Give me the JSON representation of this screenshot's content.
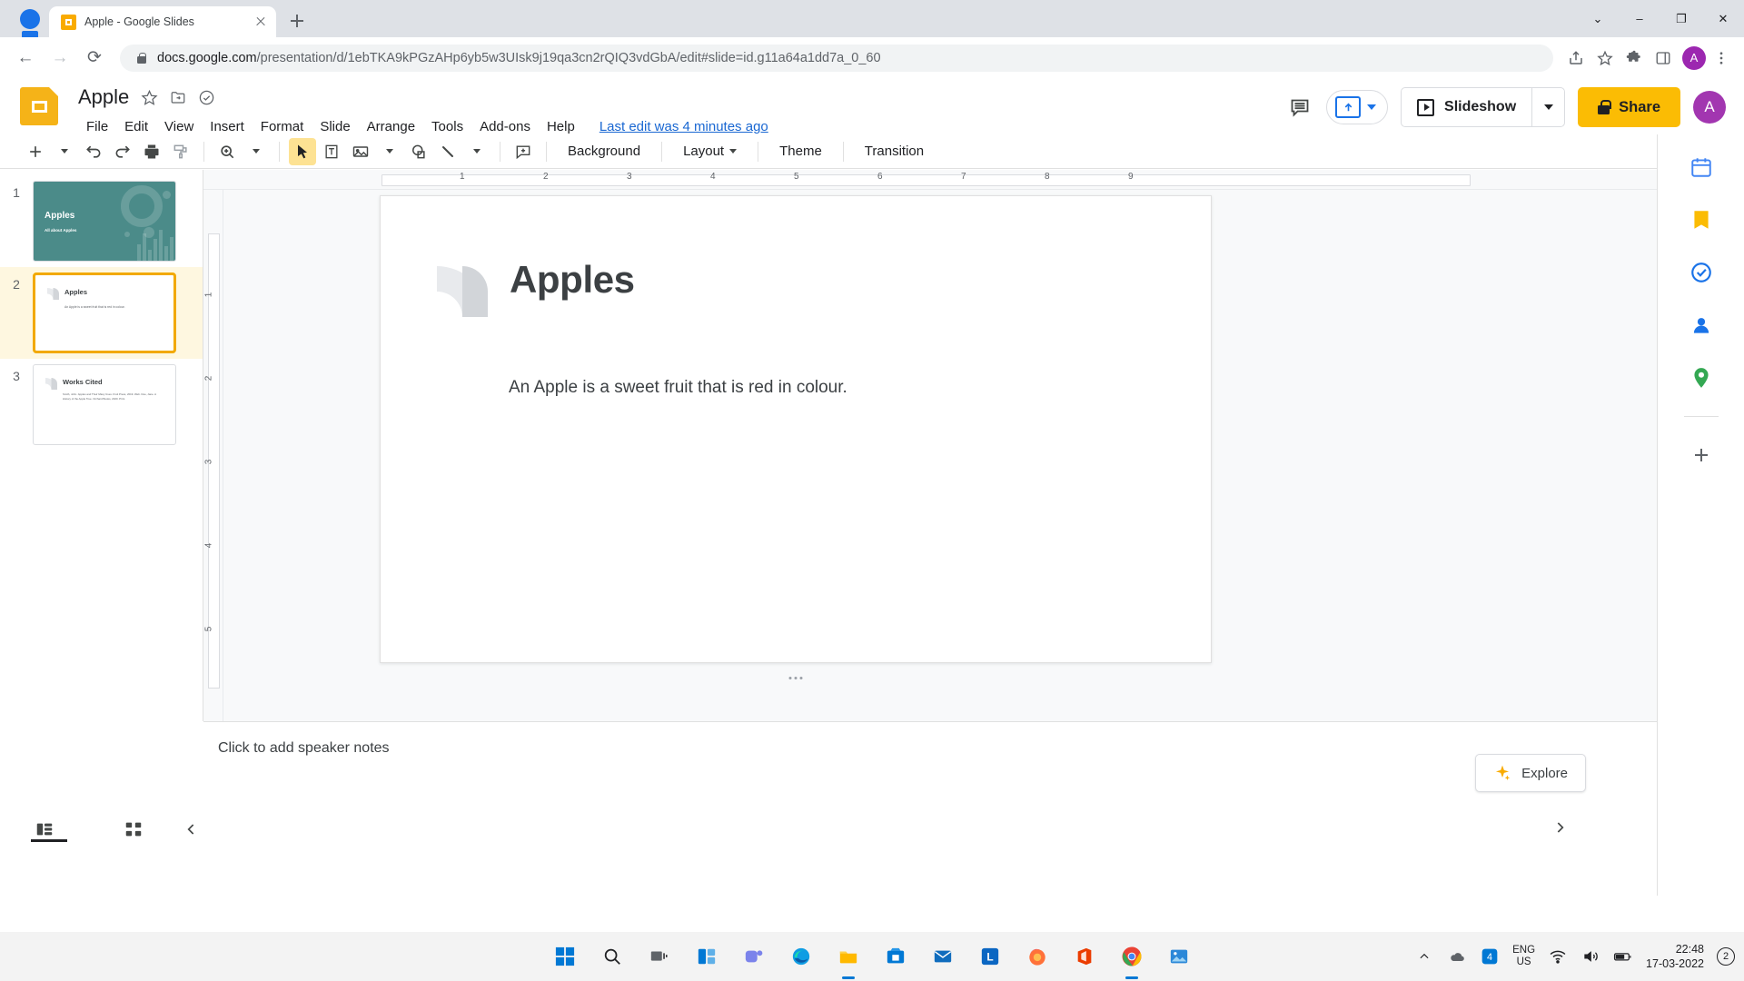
{
  "browser": {
    "tab": {
      "title": "Apple - Google Slides",
      "favicon": "slides-favicon"
    },
    "new_tab_label": "+",
    "window_controls": {
      "minimize": "–",
      "maximize": "❐",
      "close": "✕",
      "more": "⌄"
    },
    "nav": {
      "back": "←",
      "forward": "→",
      "reload": "⟳"
    },
    "url_domain": "docs.google.com",
    "url_path": "/presentation/d/1ebTKA9kPGzAHp6yb5w3UIsk9j19qa3cn2rQIQ3vdGbA/edit#slide=id.g11a64a1dd7a_0_60",
    "avatar_letter": "A"
  },
  "slides": {
    "doc_title": "Apple",
    "menus": [
      "File",
      "Edit",
      "View",
      "Insert",
      "Format",
      "Slide",
      "Arrange",
      "Tools",
      "Add-ons",
      "Help"
    ],
    "last_edit": "Last edit was 4 minutes ago",
    "slideshow_label": "Slideshow",
    "share_label": "Share",
    "avatar_letter": "A",
    "accent_yellow": "#fbbc04",
    "accent_blue": "#1a73e8",
    "toolbar": {
      "background_label": "Background",
      "layout_label": "Layout",
      "theme_label": "Theme",
      "transition_label": "Transition"
    },
    "filmstrip": [
      {
        "number": "1",
        "type": "title",
        "title": "Apples",
        "subtitle": "All about Apples",
        "selected": false,
        "bg_color": "#4b8b89"
      },
      {
        "number": "2",
        "type": "content",
        "title": "Apples",
        "body": "An Apple is a sweet fruit that is red in colour.",
        "selected": true
      },
      {
        "number": "3",
        "type": "content",
        "title": "Works Cited",
        "body": "Smith, John. Apples and Their Many Uses. Fruit Press, 2019. Web.\nDoe, Jane. A History of the Apple Tree. Orchard Books, 2020. Print.",
        "selected": false
      }
    ],
    "current_slide": {
      "heading": "Apples",
      "body": "An Apple is a sweet fruit that is red in colour."
    },
    "notes_placeholder": "Click to add speaker notes",
    "explore_label": "Explore",
    "ruler_ticks": [
      "1",
      "2",
      "3",
      "4",
      "5",
      "6",
      "7",
      "8",
      "9"
    ],
    "vruler_ticks": [
      "1",
      "2",
      "3",
      "4",
      "5"
    ]
  },
  "taskbar": {
    "language": {
      "line1": "ENG",
      "line2": "US"
    },
    "clock": {
      "time": "22:48",
      "date": "17-03-2022"
    },
    "notification_count": "2",
    "badge_count": "4",
    "apps": [
      "start-icon",
      "search-icon",
      "task-view-icon",
      "widgets-icon",
      "teams-icon",
      "edge-icon",
      "explorer-icon",
      "store-icon",
      "mail-icon",
      "linkedin-icon",
      "firefox-icon",
      "office-icon",
      "chrome-icon",
      "photos-icon"
    ]
  }
}
